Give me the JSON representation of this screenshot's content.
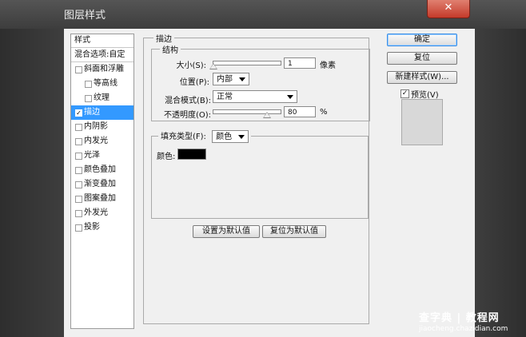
{
  "window": {
    "title": "图层样式",
    "close_glyph": "✕"
  },
  "sidebar": {
    "header": "样式",
    "blend_options": "混合选项:自定",
    "items": [
      {
        "label": "斜面和浮雕",
        "checked": false,
        "sub": false,
        "selected": false
      },
      {
        "label": "等高线",
        "checked": false,
        "sub": true,
        "selected": false
      },
      {
        "label": "纹理",
        "checked": false,
        "sub": true,
        "selected": false
      },
      {
        "label": "描边",
        "checked": true,
        "sub": false,
        "selected": true
      },
      {
        "label": "内阴影",
        "checked": false,
        "sub": false,
        "selected": false
      },
      {
        "label": "内发光",
        "checked": false,
        "sub": false,
        "selected": false
      },
      {
        "label": "光泽",
        "checked": false,
        "sub": false,
        "selected": false
      },
      {
        "label": "颜色叠加",
        "checked": false,
        "sub": false,
        "selected": false
      },
      {
        "label": "渐变叠加",
        "checked": false,
        "sub": false,
        "selected": false
      },
      {
        "label": "图案叠加",
        "checked": false,
        "sub": false,
        "selected": false
      },
      {
        "label": "外发光",
        "checked": false,
        "sub": false,
        "selected": false
      },
      {
        "label": "投影",
        "checked": false,
        "sub": false,
        "selected": false
      }
    ]
  },
  "stroke": {
    "group_title": "描边",
    "structure_title": "结构",
    "size_label": "大小(S):",
    "size_value": "1",
    "size_unit": "像素",
    "size_level": 0.0,
    "position_label": "位置(P):",
    "position_value": "内部",
    "blend_label": "混合模式(B):",
    "blend_value": "正常",
    "opacity_label": "不透明度(O):",
    "opacity_value": "80",
    "opacity_unit": "%",
    "opacity_level": 0.8,
    "fill_type_label": "填充类型(F):",
    "fill_type_value": "颜色",
    "color_label": "颜色:",
    "color_hex": "#000000",
    "set_default": "设置为默认值",
    "reset_default": "复位为默认值"
  },
  "right_panel": {
    "ok": "确定",
    "reset": "复位",
    "new_style": "新建样式(W)...",
    "preview_label": "预览(V)",
    "preview_checked": true
  },
  "watermark": {
    "main": "查字典 | 教程网",
    "sub": "jiaocheng.chazidian.com"
  }
}
